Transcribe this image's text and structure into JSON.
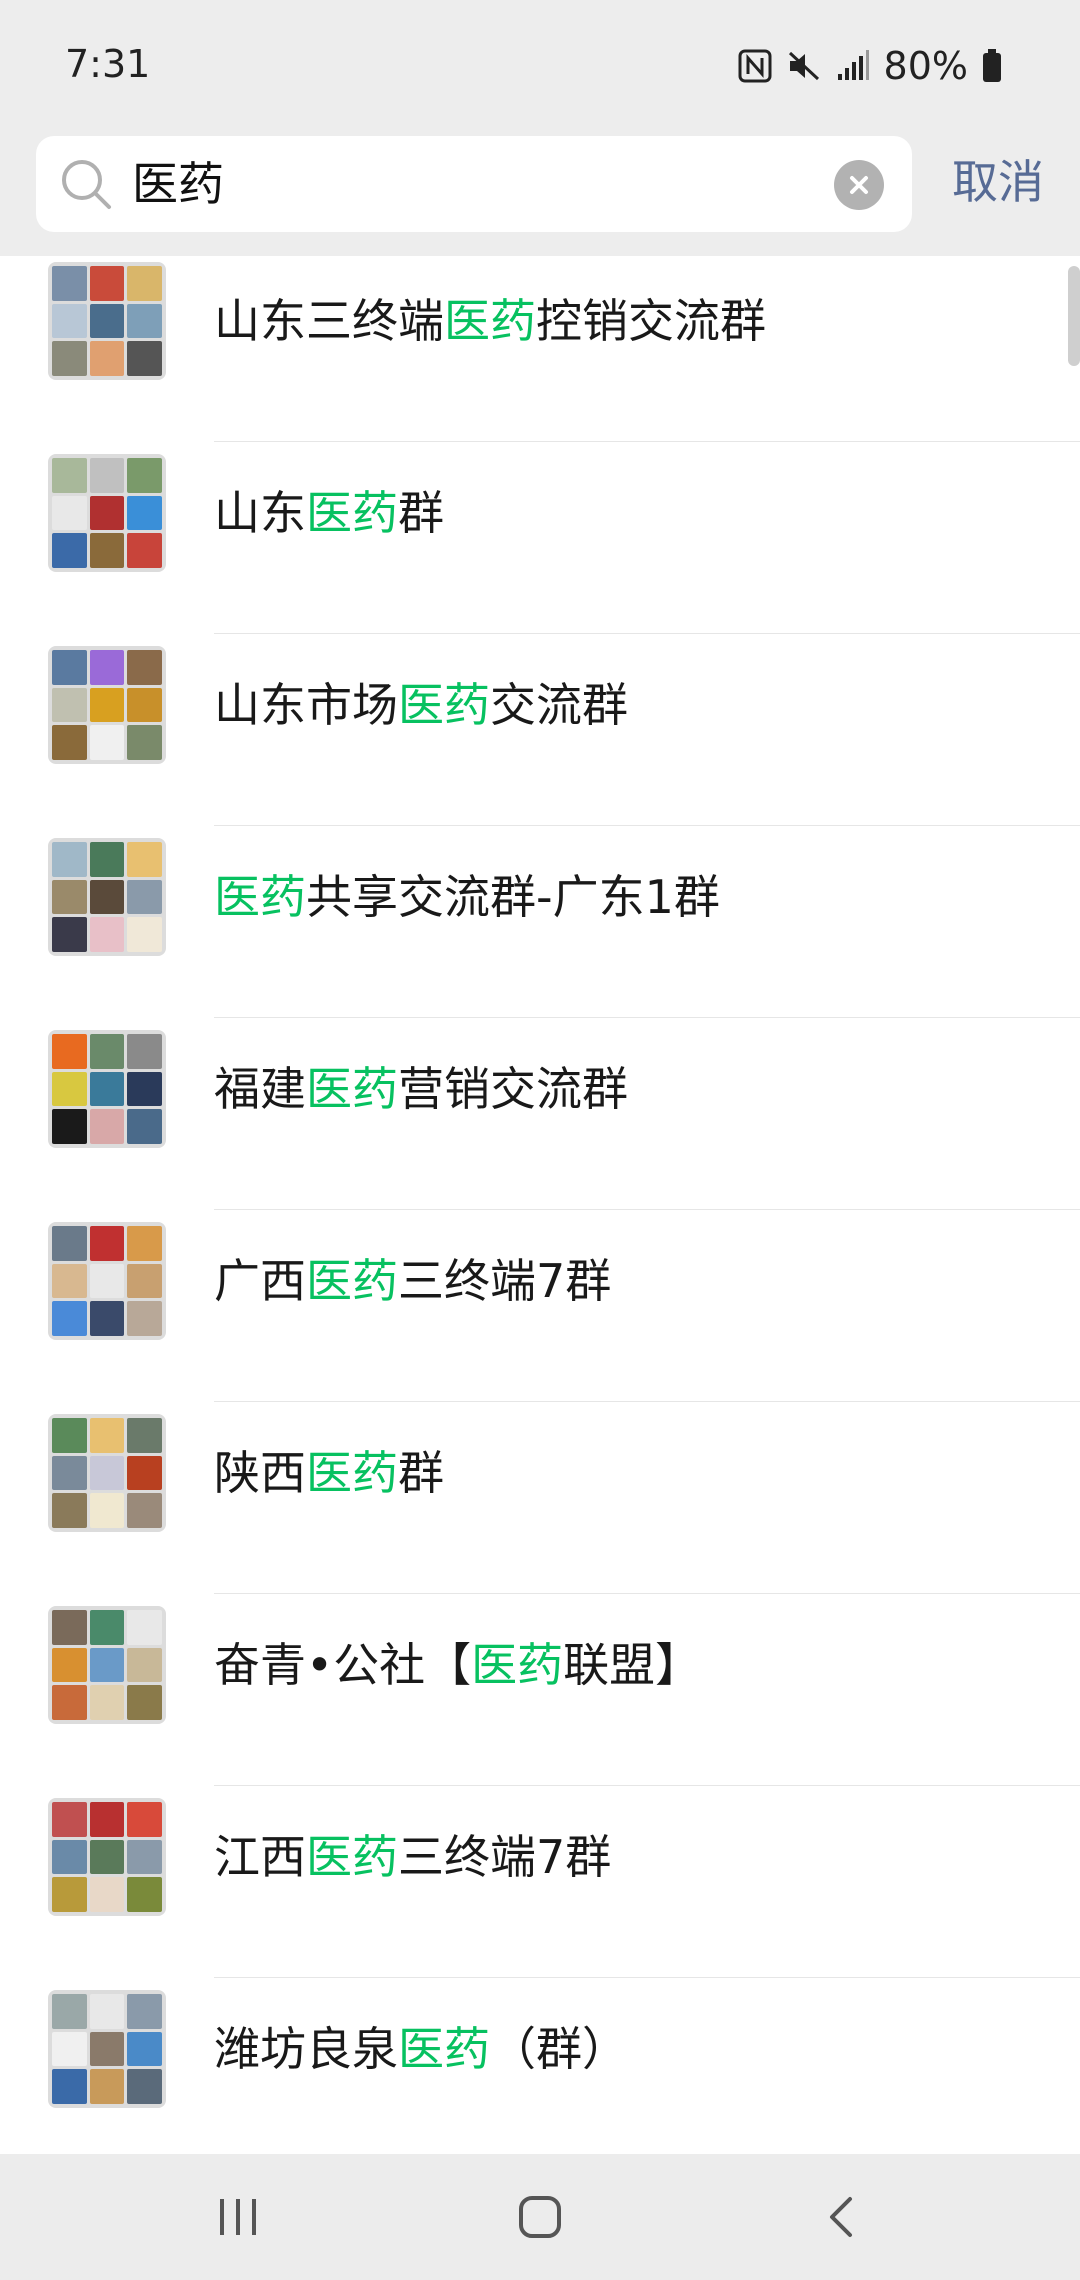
{
  "status_bar": {
    "time": "7:31",
    "battery": "80%",
    "icons": [
      "nfc-icon",
      "mute-icon",
      "signal-icon",
      "battery-icon"
    ]
  },
  "search": {
    "value": "医药",
    "placeholder": "",
    "cancel_label": "取消"
  },
  "colors": {
    "highlight": "#07c160",
    "link": "#576b95",
    "background": "#ededed"
  },
  "results": [
    {
      "before": "山东三终端",
      "match": "医药",
      "after": "控销交流群",
      "tiles": [
        "#7a8fa8",
        "#c94b3a",
        "#d9b66a",
        "#b8c7d6",
        "#4a6d8c",
        "#7e9fb8",
        "#8a8a7a",
        "#e0a070",
        "#555555"
      ]
    },
    {
      "before": "山东",
      "match": "医药",
      "after": "群",
      "tiles": [
        "#a8b89a",
        "#c0c0c0",
        "#7a9a6a",
        "#e8e8e8",
        "#b03030",
        "#3a8fd8",
        "#3b6aa8",
        "#8a6a3a",
        "#c8443a"
      ]
    },
    {
      "before": "山东市场",
      "match": "医药",
      "after": "交流群",
      "tiles": [
        "#5a7aa0",
        "#9a6ad8",
        "#8a6a4a",
        "#c0c0b0",
        "#d8a020",
        "#c8902a",
        "#8a6a3a",
        "#f0f0f0",
        "#7a8a6a"
      ]
    },
    {
      "before": "",
      "match": "医药",
      "after": "共享交流群-广东1群",
      "tiles": [
        "#a0b8c8",
        "#4a7a5a",
        "#e8c070",
        "#9a8a6a",
        "#5a4a3a",
        "#8a9aaa",
        "#3a3a4a",
        "#e8c0c8",
        "#f0e8d8"
      ]
    },
    {
      "before": "福建",
      "match": "医药",
      "after": "营销交流群",
      "tiles": [
        "#e86a20",
        "#6a8a6a",
        "#8a8a8a",
        "#d8c840",
        "#3a7a9a",
        "#2a3a5a",
        "#1a1a1a",
        "#d8a8a8",
        "#4a6a8a"
      ]
    },
    {
      "before": "广西",
      "match": "医药",
      "after": "三终端7群",
      "tiles": [
        "#6a7a8a",
        "#c03030",
        "#d89a4a",
        "#d8b890",
        "#e8e8e8",
        "#c8a070",
        "#4a8ad8",
        "#3a4a6a",
        "#b8a898"
      ]
    },
    {
      "before": "陕西",
      "match": "医药",
      "after": "群",
      "tiles": [
        "#5a8a5a",
        "#e8c070",
        "#6a7a6a",
        "#7a8a9a",
        "#c8c8d8",
        "#b84020",
        "#8a7a5a",
        "#f0e8d0",
        "#9a8a7a"
      ]
    },
    {
      "before": "奋青•公社【",
      "match": "医药",
      "after": "联盟】",
      "tiles": [
        "#7a6a5a",
        "#4a8a6a",
        "#e8e8e8",
        "#d89030",
        "#6a9ac8",
        "#c8b898",
        "#c86a3a",
        "#e0d0b0",
        "#8a7a4a"
      ]
    },
    {
      "before": "江西",
      "match": "医药",
      "after": "三终端7群",
      "tiles": [
        "#c05050",
        "#b83030",
        "#d84a3a",
        "#6a8aa8",
        "#5a7a5a",
        "#8a9aaa",
        "#b89a3a",
        "#e8d8c8",
        "#7a8a3a"
      ]
    },
    {
      "before": "潍坊良泉",
      "match": "医药",
      "after": "（群）",
      "tiles": [
        "#9aa8a8",
        "#e8e8e8",
        "#8a9aaa",
        "#f0f0f0",
        "#8a7a6a",
        "#4a8ac8",
        "#3a6aa8",
        "#c89a5a",
        "#5a6a7a"
      ]
    }
  ]
}
